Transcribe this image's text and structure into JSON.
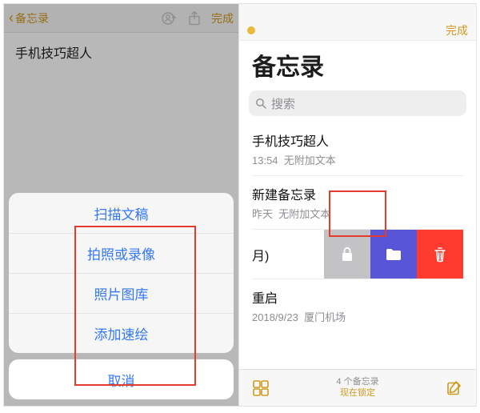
{
  "left": {
    "back_label": "备忘录",
    "done_label": "完成",
    "note_title": "手机技巧超人",
    "sheet": {
      "items": [
        "扫描文稿",
        "拍照或录像",
        "照片图库",
        "添加速绘"
      ],
      "cancel": "取消"
    }
  },
  "right": {
    "done_label": "完成",
    "header": "备忘录",
    "search_placeholder": "搜索",
    "notes": [
      {
        "title": "手机技巧超人",
        "time": "13:54",
        "preview": "无附加文本"
      },
      {
        "title": "新建备忘录",
        "time": "昨天",
        "preview": "无附加文本"
      },
      {
        "title": "",
        "time": "月)",
        "preview": ""
      },
      {
        "title": "重启",
        "time": "2018/9/23",
        "preview": "厦门机场"
      }
    ],
    "toolbar": {
      "count": "4 个备忘录",
      "status": "现在锁定"
    }
  }
}
